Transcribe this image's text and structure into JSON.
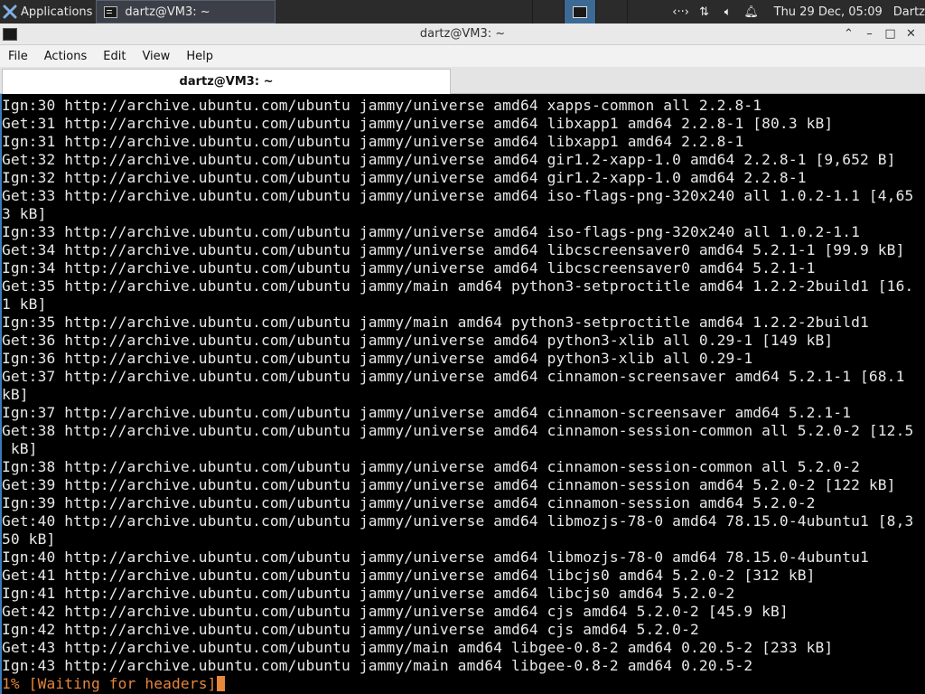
{
  "panel": {
    "applications_label": "Applications",
    "task_title": "dartz@VM3: ~",
    "clock": "Thu 29 Dec, 05:09",
    "user": "Dartz"
  },
  "window": {
    "title": "dartz@VM3: ~",
    "tab_title": "dartz@VM3: ~"
  },
  "menu": {
    "file": "File",
    "actions": "Actions",
    "edit": "Edit",
    "view": "View",
    "help": "Help"
  },
  "terminal": {
    "lines": [
      "Ign:30 http://archive.ubuntu.com/ubuntu jammy/universe amd64 xapps-common all 2.2.8-1",
      "Get:31 http://archive.ubuntu.com/ubuntu jammy/universe amd64 libxapp1 amd64 2.2.8-1 [80.3 kB]",
      "Ign:31 http://archive.ubuntu.com/ubuntu jammy/universe amd64 libxapp1 amd64 2.2.8-1",
      "Get:32 http://archive.ubuntu.com/ubuntu jammy/universe amd64 gir1.2-xapp-1.0 amd64 2.2.8-1 [9,652 B]",
      "Ign:32 http://archive.ubuntu.com/ubuntu jammy/universe amd64 gir1.2-xapp-1.0 amd64 2.2.8-1",
      "Get:33 http://archive.ubuntu.com/ubuntu jammy/universe amd64 iso-flags-png-320x240 all 1.0.2-1.1 [4,65",
      "3 kB]",
      "Ign:33 http://archive.ubuntu.com/ubuntu jammy/universe amd64 iso-flags-png-320x240 all 1.0.2-1.1",
      "Get:34 http://archive.ubuntu.com/ubuntu jammy/universe amd64 libcscreensaver0 amd64 5.2.1-1 [99.9 kB]",
      "Ign:34 http://archive.ubuntu.com/ubuntu jammy/universe amd64 libcscreensaver0 amd64 5.2.1-1",
      "Get:35 http://archive.ubuntu.com/ubuntu jammy/main amd64 python3-setproctitle amd64 1.2.2-2build1 [16.",
      "1 kB]",
      "Ign:35 http://archive.ubuntu.com/ubuntu jammy/main amd64 python3-setproctitle amd64 1.2.2-2build1",
      "Get:36 http://archive.ubuntu.com/ubuntu jammy/universe amd64 python3-xlib all 0.29-1 [149 kB]",
      "Ign:36 http://archive.ubuntu.com/ubuntu jammy/universe amd64 python3-xlib all 0.29-1",
      "Get:37 http://archive.ubuntu.com/ubuntu jammy/universe amd64 cinnamon-screensaver amd64 5.2.1-1 [68.1",
      "kB]",
      "Ign:37 http://archive.ubuntu.com/ubuntu jammy/universe amd64 cinnamon-screensaver amd64 5.2.1-1",
      "Get:38 http://archive.ubuntu.com/ubuntu jammy/universe amd64 cinnamon-session-common all 5.2.0-2 [12.5",
      " kB]",
      "Ign:38 http://archive.ubuntu.com/ubuntu jammy/universe amd64 cinnamon-session-common all 5.2.0-2",
      "Get:39 http://archive.ubuntu.com/ubuntu jammy/universe amd64 cinnamon-session amd64 5.2.0-2 [122 kB]",
      "Ign:39 http://archive.ubuntu.com/ubuntu jammy/universe amd64 cinnamon-session amd64 5.2.0-2",
      "Get:40 http://archive.ubuntu.com/ubuntu jammy/universe amd64 libmozjs-78-0 amd64 78.15.0-4ubuntu1 [8,3",
      "50 kB]",
      "Ign:40 http://archive.ubuntu.com/ubuntu jammy/universe amd64 libmozjs-78-0 amd64 78.15.0-4ubuntu1",
      "Get:41 http://archive.ubuntu.com/ubuntu jammy/universe amd64 libcjs0 amd64 5.2.0-2 [312 kB]",
      "Ign:41 http://archive.ubuntu.com/ubuntu jammy/universe amd64 libcjs0 amd64 5.2.0-2",
      "Get:42 http://archive.ubuntu.com/ubuntu jammy/universe amd64 cjs amd64 5.2.0-2 [45.9 kB]",
      "Ign:42 http://archive.ubuntu.com/ubuntu jammy/universe amd64 cjs amd64 5.2.0-2",
      "Get:43 http://archive.ubuntu.com/ubuntu jammy/main amd64 libgee-0.8-2 amd64 0.20.5-2 [233 kB]",
      "Ign:43 http://archive.ubuntu.com/ubuntu jammy/main amd64 libgee-0.8-2 amd64 0.20.5-2"
    ],
    "status_line": "1% [Waiting for headers]",
    "status_color": "#e8863a"
  }
}
